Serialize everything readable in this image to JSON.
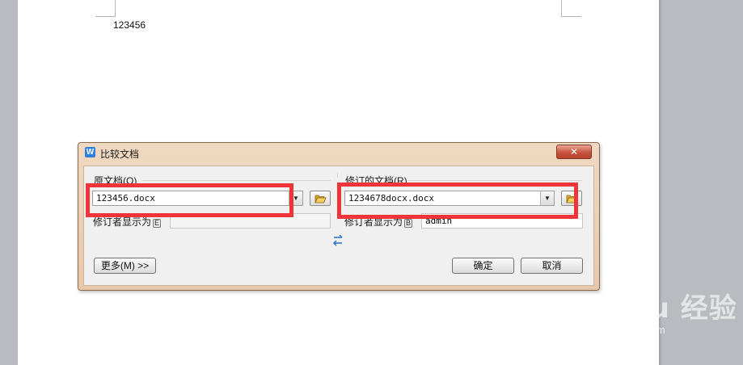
{
  "document": {
    "text": "123456"
  },
  "dialog": {
    "title": "比较文档",
    "close_glyph": "✕",
    "original": {
      "label": "原文档",
      "hotkey": "(O)",
      "file": "123456.docx",
      "author_label": "修订者显示为",
      "author_hotkey": "E",
      "author_value": ""
    },
    "revised": {
      "label": "修订的文档",
      "hotkey": "(R)",
      "file": "1234678docx.docx",
      "author_label": "修订者显示为",
      "author_hotkey": "B",
      "author_value": "admin"
    },
    "swap_glyph": "⇆",
    "more_button": "更多(M) >>",
    "ok_button": "确定",
    "cancel_button": "取消"
  },
  "watermark": {
    "main": "Bai du 经验",
    "sub": "jingyan.baidu.com"
  },
  "colors": {
    "highlight": "#f0343c",
    "dialog_frame": "#e8c8aa",
    "app_icon": "#2f7fe0"
  }
}
